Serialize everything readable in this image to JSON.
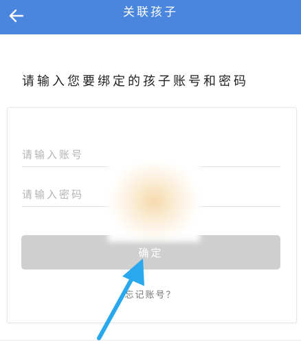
{
  "header": {
    "title": "关联孩子",
    "back_icon": "back-arrow-icon",
    "background_color": "#4a86dd"
  },
  "prompt": "请输入您要绑定的孩子账号和密码",
  "form": {
    "account_placeholder": "请输入账号",
    "password_placeholder": "请输入密码",
    "confirm_label": "确定",
    "forgot_label": "忘记账号？"
  },
  "annotation": {
    "arrow_color": "#2aa8ee"
  }
}
